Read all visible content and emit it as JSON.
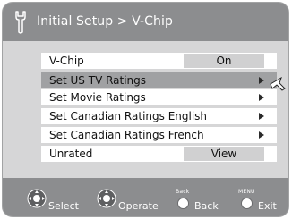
{
  "header": {
    "title": "Initial Setup > V-Chip"
  },
  "menu": {
    "items": [
      {
        "label": "V-Chip",
        "value": "On",
        "kind": "value"
      },
      {
        "label": "Set US TV Ratings",
        "kind": "submenu",
        "selected": true
      },
      {
        "label": "Set Movie Ratings",
        "kind": "submenu"
      },
      {
        "label": "Set Canadian Ratings English",
        "kind": "submenu"
      },
      {
        "label": "Set Canadian Ratings French",
        "kind": "submenu"
      },
      {
        "label": "Unrated",
        "value": "View",
        "kind": "value"
      }
    ]
  },
  "footer": {
    "select_label": "Select",
    "operate_label": "Operate",
    "back_small": "Back",
    "back_label": "Back",
    "menu_small": "MENU",
    "exit_label": "Exit"
  },
  "icons": {
    "header_icon": "wrench-icon",
    "cursor": "pointer-arrow-icon",
    "select": "dpad-icon",
    "operate": "dpad-icon",
    "back": "circle-button-icon",
    "exit": "circle-button-icon"
  },
  "colors": {
    "header_bg": "#8c8d8f",
    "panel_bg": "#d6d6d7",
    "row_bg": "#ffffff",
    "selected_row_bg": "#a0a1a3"
  }
}
